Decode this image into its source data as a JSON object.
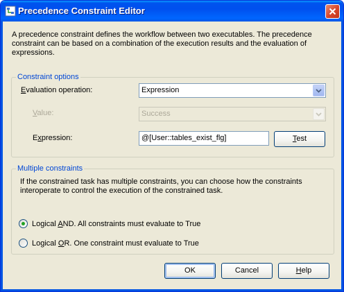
{
  "window": {
    "title": "Precedence Constraint Editor"
  },
  "intro_text": "A precedence constraint defines the workflow between two executables. The precedence constraint can be based on a combination of the execution results and the evaluation of expressions.",
  "constraint_options": {
    "legend": "Constraint options",
    "evaluation_label_pre": "",
    "evaluation_label_key": "E",
    "evaluation_label_post": "valuation operation:",
    "evaluation_value": "Expression",
    "value_label_pre": "",
    "value_label_key": "V",
    "value_label_post": "alue:",
    "value_value": "Success",
    "expression_label_pre": "E",
    "expression_label_key": "x",
    "expression_label_post": "pression:",
    "expression_value": "@[User::tables_exist_flg]",
    "test_label_pre": "",
    "test_label_key": "T",
    "test_label_post": "est"
  },
  "multiple_constraints": {
    "legend": "Multiple constraints",
    "description": "If the constrained task has multiple constraints, you can choose how the constraints interoperate to control the execution of the constrained task.",
    "and_label_pre": "Logical ",
    "and_label_key": "A",
    "and_label_post": "ND. All constraints must evaluate to True",
    "and_checked": true,
    "or_label_pre": "Logical ",
    "or_label_key": "O",
    "or_label_post": "R. One constraint must evaluate to True",
    "or_checked": false
  },
  "buttons": {
    "ok": "OK",
    "cancel": "Cancel",
    "help_key": "H",
    "help_post": "elp"
  },
  "colors": {
    "titlebar": "#0054e3",
    "legend_text": "#0046d5",
    "radio_dot": "#21a121"
  }
}
